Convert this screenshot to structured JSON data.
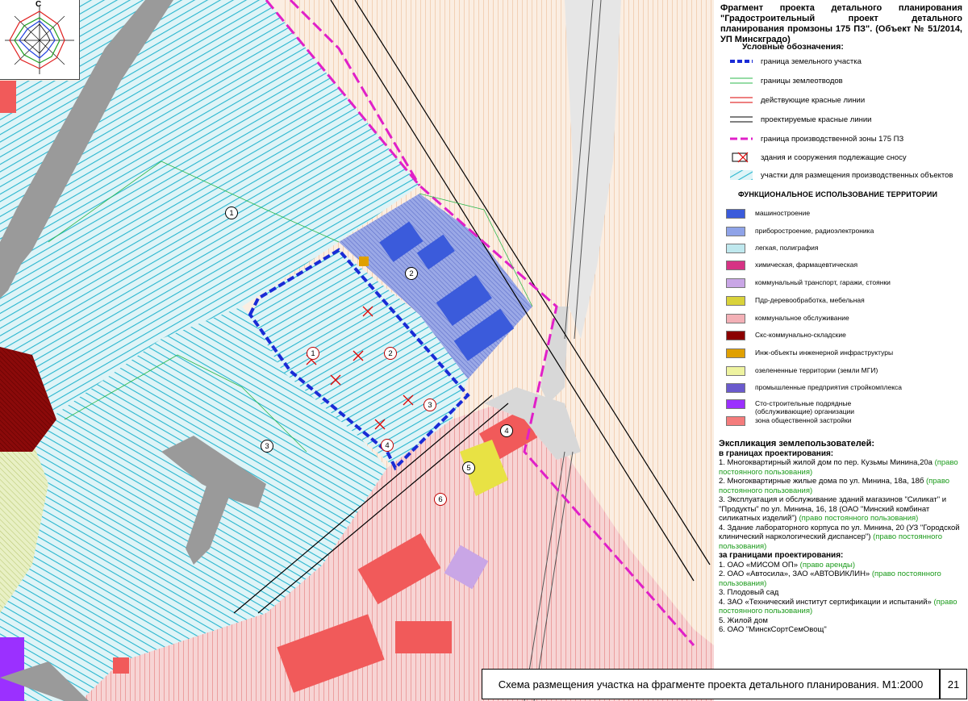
{
  "title": "Фрагмент проекта детального планирования \"Градостроительный проект детального планирования промзоны 175 ПЗ\". (Объект № 51/2014, УП Минскградо)",
  "compass_label": "С",
  "legend": {
    "heading": "Условные обозначения:",
    "items": [
      "граница  земельного участка",
      "границы землеотводов",
      "действующие красные линии",
      "проектируемые красные линии",
      "граница производственной зоны 175 ПЗ",
      "здания и сооружения подлежащие сносу",
      "участки для размещения производственных объектов"
    ]
  },
  "functional": {
    "heading": "ФУНКЦИОНАЛЬНОЕ ИСПОЛЬЗОВАНИЕ ТЕРРИТОРИИ",
    "items": [
      {
        "label": "машиностроение",
        "color": "#3b5bdb"
      },
      {
        "label": "приборостроение, радиоэлектроника",
        "color": "#8fa3e8"
      },
      {
        "label": "легкая, полиграфия",
        "color": "#bfe8ee"
      },
      {
        "label": "химическая, фармацевтическая",
        "color": "#d63384"
      },
      {
        "label": "коммунальный транспорт, гаражи, стоянки",
        "color": "#c9a6e6"
      },
      {
        "label": "Пдр-деревообработка, мебельная",
        "color": "#d9d23a"
      },
      {
        "label": "коммунальное обслуживание",
        "color": "#f3b0b6"
      },
      {
        "label": "Скс-коммунально-складские",
        "color": "#8b0000"
      },
      {
        "label": "Инж-объекты инженерной инфраструктуры",
        "color": "#e0a000"
      },
      {
        "label": "озелененные территории (земли МГИ)",
        "color": "#eef3a0"
      },
      {
        "label": "промышленные предприятия стройкомплекса",
        "color": "#6a5acd"
      },
      {
        "label": "Сто-строительные подрядные (обслуживающие) организации",
        "color": "#9b30ff"
      },
      {
        "label": "зона общественной застройки",
        "color": "#f47c7c"
      }
    ]
  },
  "explication": {
    "heading": "Экспликация землепользователей:",
    "inside_heading": "в границах проектирования:",
    "inside": [
      {
        "text": "1.  Многоквартирный жилой дом по пер. Кузьмы Минина,20а ",
        "right": "(право постоянного пользования)"
      },
      {
        "text": "2. Многоквартирные жилые дома по ул. Минина, 18а, 18б ",
        "right": "(право постоянного пользования)"
      },
      {
        "text": "3. Эксплуатация и обслуживание зданий магазинов \"Силикат\" и \"Продукты\" по ул. Минина, 16, 18 (ОАО \"Минский комбинат силикатных изделий\") ",
        "right": "(право постоянного пользования)"
      },
      {
        "text": "4.  Здание лабораторного корпуса по ул. Минина, 20 (УЗ \"Городской клинический наркологический диспансер\") ",
        "right": "(право постоянного пользования)"
      }
    ],
    "outside_heading": "за границами проектирования:",
    "outside": [
      {
        "text": "1.  ОАО «МИСОМ ОП» ",
        "right": "(право аренды)"
      },
      {
        "text": "2. ОАО «Автосила», ЗАО «АВТОВИКЛИН» ",
        "right": "(право постоянного пользования)"
      },
      {
        "text": "3. Плодовый сад",
        "right": ""
      },
      {
        "text": "4. ЗАО «Технический институт сертификации и испытаний» ",
        "right": "(право постоянного пользования)"
      },
      {
        "text": "5. Жилой дом",
        "right": ""
      },
      {
        "text": "6. ОАО \"МинскСортСемОвощ\"",
        "right": ""
      }
    ]
  },
  "map_markers": [
    {
      "label": "1",
      "kind": "plain"
    },
    {
      "label": "2",
      "kind": "plain"
    },
    {
      "label": "3",
      "kind": "plain"
    },
    {
      "label": "1",
      "kind": "red"
    },
    {
      "label": "2",
      "kind": "red"
    },
    {
      "label": "3",
      "kind": "red"
    },
    {
      "label": "4",
      "kind": "red"
    },
    {
      "label": "4",
      "kind": "plain"
    },
    {
      "label": "5",
      "kind": "plain"
    },
    {
      "label": "6",
      "kind": "red"
    }
  ],
  "caption": "Схема размещения участка на фрагменте проекта детального планирования.  М1:2000",
  "page_number": "21"
}
